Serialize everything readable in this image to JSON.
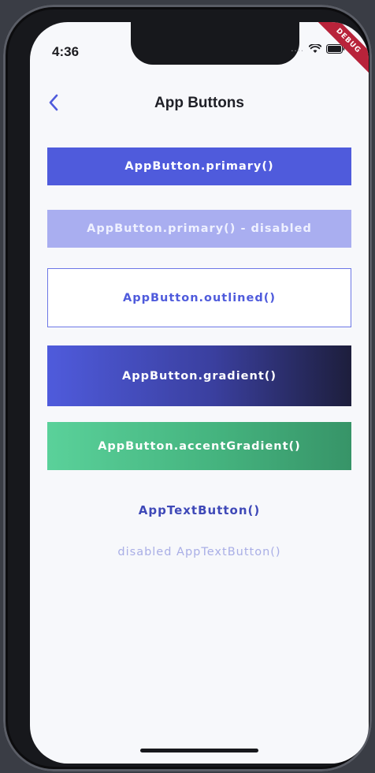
{
  "status_bar": {
    "time": "4:36",
    "signal_label": "....",
    "debug_banner": "DEBUG"
  },
  "app_bar": {
    "title": "App Buttons",
    "back_icon": "chevron-left-icon"
  },
  "buttons": {
    "primary": "AppButton.primary()",
    "primary_disabled": "AppButton.primary() - disabled",
    "outlined": "AppButton.outlined()",
    "gradient": "AppButton.gradient()",
    "accent_gradient": "AppButton.accentGradient()",
    "text_button": "AppTextButton()",
    "text_button_disabled": "disabled AppTextButton()"
  },
  "colors": {
    "primary": "#4f5bdc",
    "primary_disabled": "#a9aef0",
    "gradient_end": "#1d1e3c",
    "accent_start": "#5ad19a",
    "accent_end": "#379468",
    "text_button": "#3f49b8",
    "debug_banner": "#b8233a"
  }
}
